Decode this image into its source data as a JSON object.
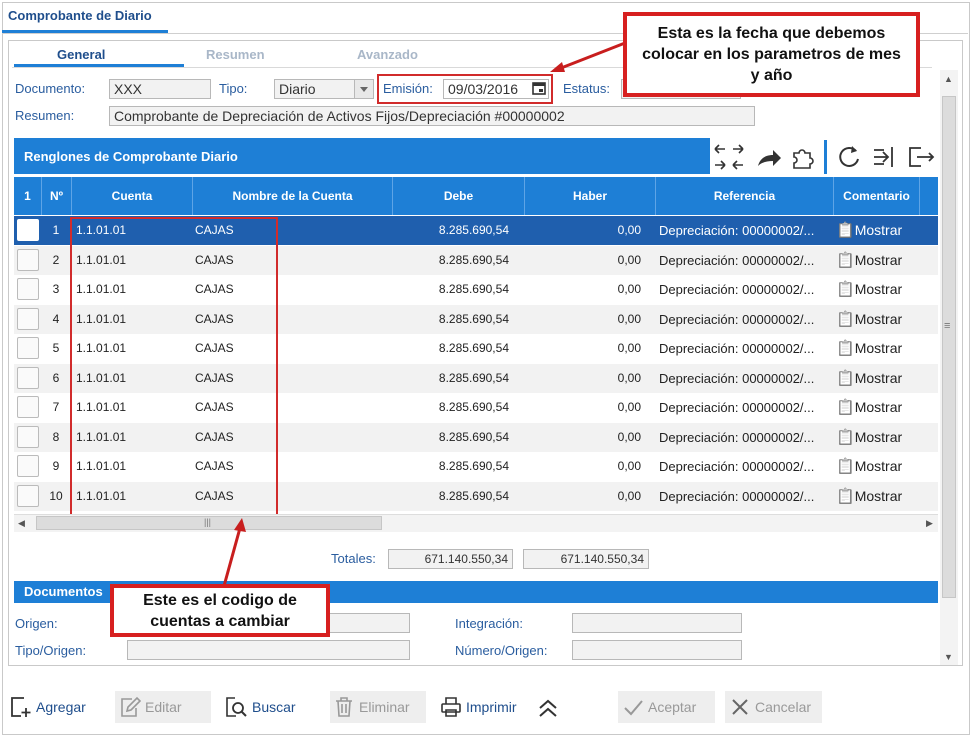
{
  "window": {
    "title": "Comprobante de Diario"
  },
  "tabs": [
    {
      "label": "General"
    },
    {
      "label": "Resumen"
    },
    {
      "label": "Avanzado"
    }
  ],
  "form": {
    "documento_label": "Documento:",
    "documento_value": "XXX",
    "tipo_label": "Tipo:",
    "tipo_value": "Diario",
    "emision_label": "Emisión:",
    "emision_value": "09/03/2016",
    "estatus_label": "Estatus:",
    "estatus_value": "",
    "resumen_label": "Resumen:",
    "resumen_value": "Comprobante de Depreciación de Activos Fijos/Depreciación #00000002"
  },
  "grid": {
    "section_title": "Renglones de Comprobante Diario",
    "columns": [
      "1",
      "Nº",
      "Cuenta",
      "Nombre de la Cuenta",
      "Debe",
      "Haber",
      "Referencia",
      "Comentario"
    ],
    "rows": [
      {
        "n": "1",
        "cuenta": "1.1.01.01",
        "nombre": "CAJAS",
        "debe": "8.285.690,54",
        "haber": "0,00",
        "referencia": "Depreciación: 00000002/...",
        "comentario": "Mostrar"
      },
      {
        "n": "2",
        "cuenta": "1.1.01.01",
        "nombre": "CAJAS",
        "debe": "8.285.690,54",
        "haber": "0,00",
        "referencia": "Depreciación: 00000002/...",
        "comentario": "Mostrar"
      },
      {
        "n": "3",
        "cuenta": "1.1.01.01",
        "nombre": "CAJAS",
        "debe": "8.285.690,54",
        "haber": "0,00",
        "referencia": "Depreciación: 00000002/...",
        "comentario": "Mostrar"
      },
      {
        "n": "4",
        "cuenta": "1.1.01.01",
        "nombre": "CAJAS",
        "debe": "8.285.690,54",
        "haber": "0,00",
        "referencia": "Depreciación: 00000002/...",
        "comentario": "Mostrar"
      },
      {
        "n": "5",
        "cuenta": "1.1.01.01",
        "nombre": "CAJAS",
        "debe": "8.285.690,54",
        "haber": "0,00",
        "referencia": "Depreciación: 00000002/...",
        "comentario": "Mostrar"
      },
      {
        "n": "6",
        "cuenta": "1.1.01.01",
        "nombre": "CAJAS",
        "debe": "8.285.690,54",
        "haber": "0,00",
        "referencia": "Depreciación: 00000002/...",
        "comentario": "Mostrar"
      },
      {
        "n": "7",
        "cuenta": "1.1.01.01",
        "nombre": "CAJAS",
        "debe": "8.285.690,54",
        "haber": "0,00",
        "referencia": "Depreciación: 00000002/...",
        "comentario": "Mostrar"
      },
      {
        "n": "8",
        "cuenta": "1.1.01.01",
        "nombre": "CAJAS",
        "debe": "8.285.690,54",
        "haber": "0,00",
        "referencia": "Depreciación: 00000002/...",
        "comentario": "Mostrar"
      },
      {
        "n": "9",
        "cuenta": "1.1.01.01",
        "nombre": "CAJAS",
        "debe": "8.285.690,54",
        "haber": "0,00",
        "referencia": "Depreciación: 00000002/...",
        "comentario": "Mostrar"
      },
      {
        "n": "10",
        "cuenta": "1.1.01.01",
        "nombre": "CAJAS",
        "debe": "8.285.690,54",
        "haber": "0,00",
        "referencia": "Depreciación: 00000002/...",
        "comentario": "Mostrar"
      }
    ],
    "totales_label": "Totales:",
    "total_debe": "671.140.550,34",
    "total_haber": "671.140.550,34"
  },
  "documentos": {
    "section_title": "Documentos",
    "origen_label": "Origen:",
    "tipo_origen_label": "Tipo/Origen:",
    "integracion_label": "Integración:",
    "numero_origen_label": "Número/Origen:"
  },
  "buttons": {
    "agregar": "Agregar",
    "editar": "Editar",
    "buscar": "Buscar",
    "eliminar": "Eliminar",
    "imprimir": "Imprimir",
    "aceptar": "Aceptar",
    "cancelar": "Cancelar"
  },
  "callouts": {
    "fecha": "Esta es la fecha que debemos colocar en los parametros de mes y año",
    "codigo": "Este es el codigo de cuentas a cambiar"
  },
  "colors": {
    "accent": "#1e7fd6",
    "selected_row": "#1f5fae",
    "annotation": "#d12b2b"
  }
}
